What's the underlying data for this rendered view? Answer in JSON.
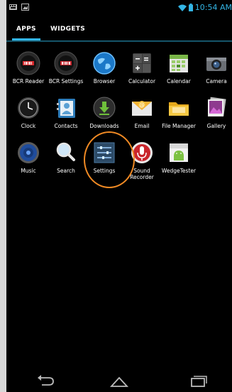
{
  "status_bar": {
    "time": "10:54 AM"
  },
  "tabs": [
    {
      "label": "APPS",
      "selected": true
    },
    {
      "label": "WIDGETS",
      "selected": false
    }
  ],
  "apps": [
    {
      "label": "BCR Reader",
      "icon": "barcode-reader-icon"
    },
    {
      "label": "BCR Settings",
      "icon": "barcode-settings-icon"
    },
    {
      "label": "Browser",
      "icon": "globe-icon"
    },
    {
      "label": "Calculator",
      "icon": "calculator-icon"
    },
    {
      "label": "Calendar",
      "icon": "calendar-icon"
    },
    {
      "label": "Camera",
      "icon": "camera-icon"
    },
    {
      "label": "Clock",
      "icon": "clock-icon"
    },
    {
      "label": "Contacts",
      "icon": "contacts-icon"
    },
    {
      "label": "Downloads",
      "icon": "download-icon"
    },
    {
      "label": "Email",
      "icon": "email-icon"
    },
    {
      "label": "File Manager",
      "icon": "folder-icon"
    },
    {
      "label": "Gallery",
      "icon": "gallery-icon"
    },
    {
      "label": "Music",
      "icon": "speaker-icon"
    },
    {
      "label": "Search",
      "icon": "magnifier-icon"
    },
    {
      "label": "Settings",
      "icon": "settings-sliders-icon",
      "highlighted": true
    },
    {
      "label": "Sound Recorder",
      "icon": "microphone-icon"
    },
    {
      "label": "WedgeTester",
      "icon": "android-icon"
    }
  ],
  "colors": {
    "accent": "#33b5e5",
    "highlight_ring": "#f08a24"
  }
}
